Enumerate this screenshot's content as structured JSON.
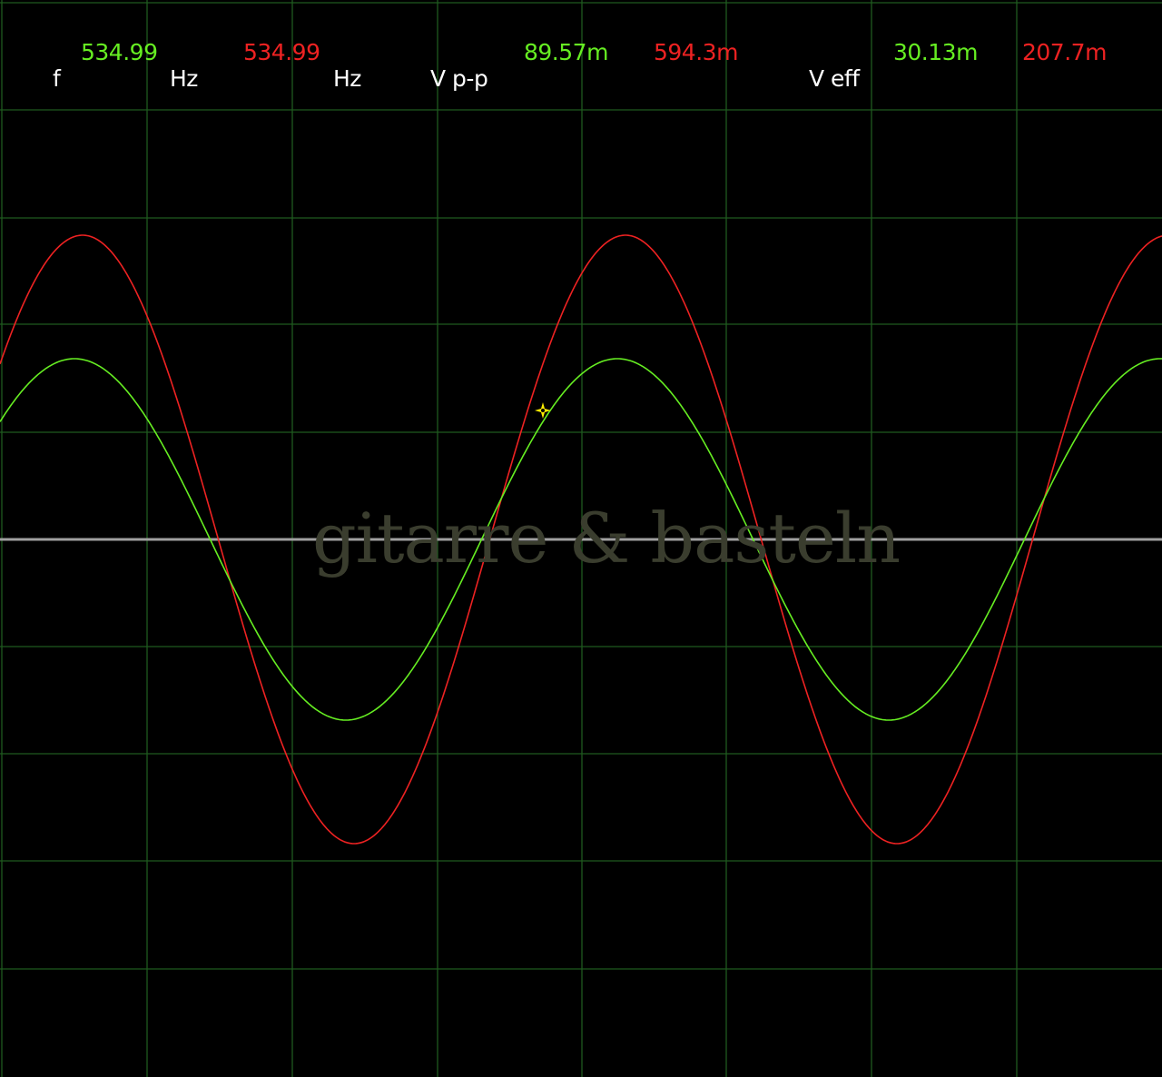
{
  "readouts": {
    "freq_label": "f",
    "freq_ch1": "534.99",
    "freq_unit_ch1": "Hz",
    "freq_ch2": "534.99",
    "freq_unit_ch2": "Hz",
    "vpp_label": "V p-p",
    "vpp_ch1": "89.57m",
    "vpp_ch2": "594.3m",
    "veff_label": "V eff",
    "veff_ch1": "30.13m",
    "veff_ch2": "207.7m"
  },
  "watermark": "gitarre & basteln",
  "colors": {
    "background": "#000000",
    "grid": "#1f5a1f",
    "center_line": "#a0a0a0",
    "channel1": "#66ee22",
    "channel2": "#ee2222",
    "label": "#ffffff",
    "cursor": "#ffee00",
    "watermark": "#3a3d2e"
  },
  "traces": {
    "channel1": {
      "color": "green",
      "frequency_hz": 534.99,
      "vpp": "89.57m",
      "veff": "30.13m"
    },
    "channel2": {
      "color": "red",
      "frequency_hz": 534.99,
      "vpp": "594.3m",
      "veff": "207.7m"
    }
  },
  "cursor_icon": "crosshair-cursor-icon"
}
